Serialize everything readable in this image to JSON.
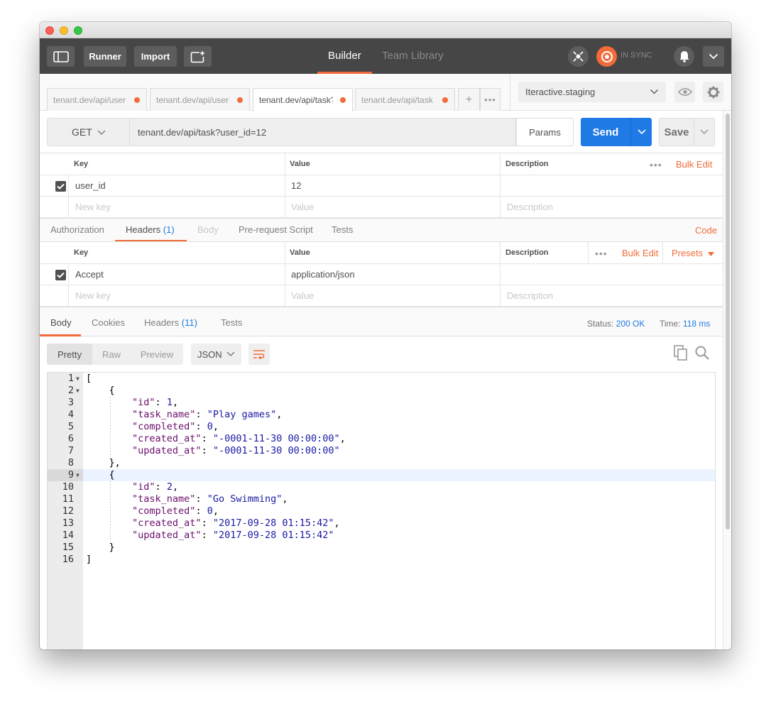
{
  "topbar": {
    "runner_label": "Runner",
    "import_label": "Import",
    "builder_label": "Builder",
    "team_library_label": "Team Library",
    "sync_label": "IN SYNC"
  },
  "request_tabs": [
    {
      "label": "tenant.dev/api/user",
      "active": false
    },
    {
      "label": "tenant.dev/api/user",
      "active": false
    },
    {
      "label": "tenant.dev/api/task?",
      "active": true
    },
    {
      "label": "tenant.dev/api/task",
      "active": false
    }
  ],
  "environment": {
    "selected": "Iteractive.staging"
  },
  "request": {
    "method": "GET",
    "url": "tenant.dev/api/task?user_id=12",
    "params_label": "Params",
    "send_label": "Send",
    "save_label": "Save"
  },
  "params_table": {
    "headers": {
      "key": "Key",
      "value": "Value",
      "description": "Description"
    },
    "bulk_edit": "Bulk Edit",
    "rows": [
      {
        "key": "user_id",
        "value": "12",
        "description": ""
      }
    ],
    "placeholder": {
      "key": "New key",
      "value": "Value",
      "description": "Description"
    }
  },
  "request_subtabs": {
    "authorization": "Authorization",
    "headers": "Headers",
    "headers_count": "(1)",
    "body": "Body",
    "prerequest": "Pre-request Script",
    "tests": "Tests",
    "code": "Code"
  },
  "headers_table": {
    "headers": {
      "key": "Key",
      "value": "Value",
      "description": "Description"
    },
    "bulk_edit": "Bulk Edit",
    "presets": "Presets",
    "rows": [
      {
        "key": "Accept",
        "value": "application/json",
        "description": ""
      }
    ],
    "placeholder": {
      "key": "New key",
      "value": "Value",
      "description": "Description"
    }
  },
  "response_tabs": {
    "body": "Body",
    "cookies": "Cookies",
    "headers": "Headers",
    "headers_count": "(11)",
    "tests": "Tests",
    "status_label": "Status:",
    "status_value": "200 OK",
    "time_label": "Time:",
    "time_value": "118 ms"
  },
  "view": {
    "pretty": "Pretty",
    "raw": "Raw",
    "preview": "Preview",
    "format": "JSON"
  },
  "code_lines": [
    "[",
    "    {",
    "        \"id\": 1,",
    "        \"task_name\": \"Play games\",",
    "        \"completed\": 0,",
    "        \"created_at\": \"-0001-11-30 00:00:00\",",
    "        \"updated_at\": \"-0001-11-30 00:00:00\"",
    "    },",
    "    {",
    "        \"id\": 2,",
    "        \"task_name\": \"Go Swimming\",",
    "        \"completed\": 0,",
    "        \"created_at\": \"2017-09-28 01:15:42\",",
    "        \"updated_at\": \"2017-09-28 01:15:42\"",
    "    }",
    "]"
  ],
  "highlighted_line": 9,
  "colors": {
    "accent": "#f26b3a",
    "send": "#1f7ae6",
    "link": "#1f7ae6"
  }
}
